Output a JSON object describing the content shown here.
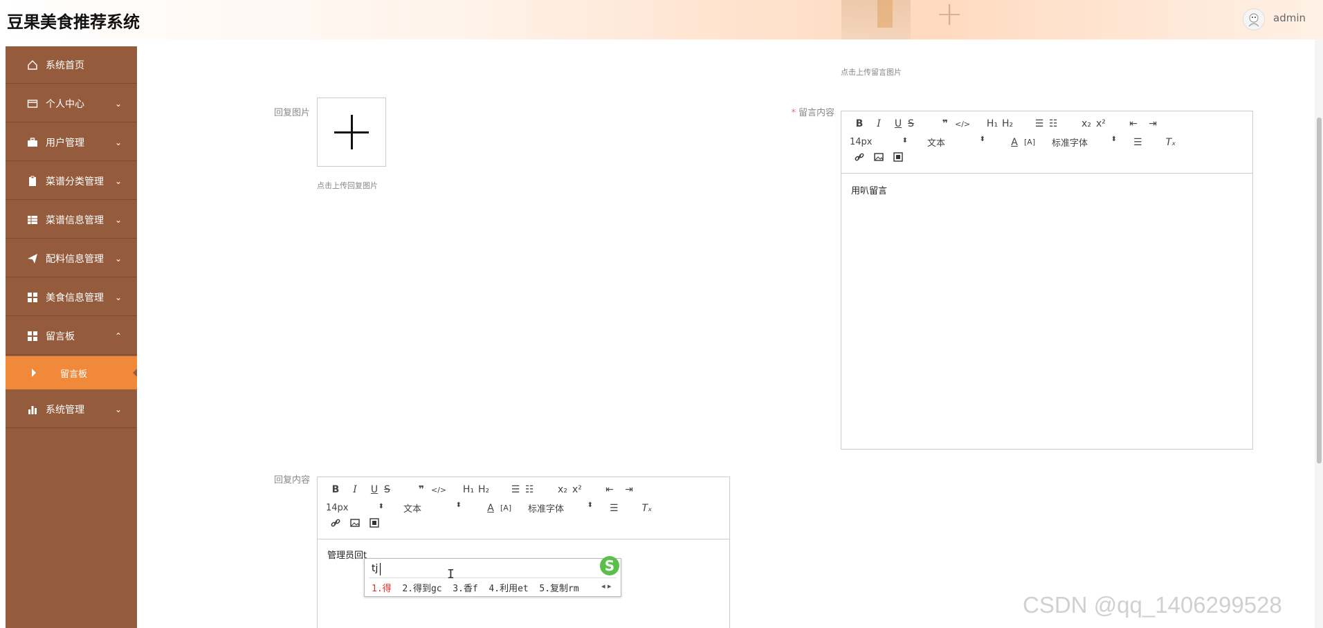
{
  "app": {
    "title": "豆果美食推荐系统",
    "user": "admin"
  },
  "sidebar": {
    "items": [
      {
        "label": "系统首页",
        "icon": "home-icon",
        "chevron": ""
      },
      {
        "label": "个人中心",
        "icon": "card-icon",
        "chevron": "⌄"
      },
      {
        "label": "用户管理",
        "icon": "briefcase-icon",
        "chevron": "⌄"
      },
      {
        "label": "菜谱分类管理",
        "icon": "clipboard-icon",
        "chevron": "⌄"
      },
      {
        "label": "菜谱信息管理",
        "icon": "grid-icon",
        "chevron": "⌄"
      },
      {
        "label": "配料信息管理",
        "icon": "send-icon",
        "chevron": "⌄"
      },
      {
        "label": "美食信息管理",
        "icon": "apps-icon",
        "chevron": "⌄"
      },
      {
        "label": "留言板",
        "icon": "apps-icon",
        "chevron": "⌃"
      },
      {
        "label": "系统管理",
        "icon": "bar-chart-icon",
        "chevron": "⌄"
      }
    ],
    "active_sub": "留言板"
  },
  "form": {
    "top_hint": "点击上传留言图片",
    "reply_image_label": "回复图片",
    "reply_image_hint": "点击上传回复图片",
    "message_content_label": "留言内容",
    "message_content_required": "*",
    "message_content_text": "用叭留言",
    "reply_content_label": "回复内容",
    "reply_content_text": "管理员回t"
  },
  "toolbar": {
    "row1": [
      "B",
      "I",
      "U",
      "S",
      "❞",
      "</>",
      "H₁",
      "H₂",
      "☰",
      "☷",
      "x₂",
      "x²",
      "⇤",
      "⇥"
    ],
    "font_size": "14px",
    "block_type": "文本",
    "font_family": "标准字体",
    "row3_icons": [
      "link-icon",
      "image-icon",
      "video-icon"
    ]
  },
  "ime": {
    "input": "tj",
    "candidates": [
      "1.得",
      "2.得到gc",
      "3.香f",
      "4.利用et",
      "5.复制rm"
    ],
    "logo": "S"
  },
  "watermark": "CSDN @qq_1406299528"
}
